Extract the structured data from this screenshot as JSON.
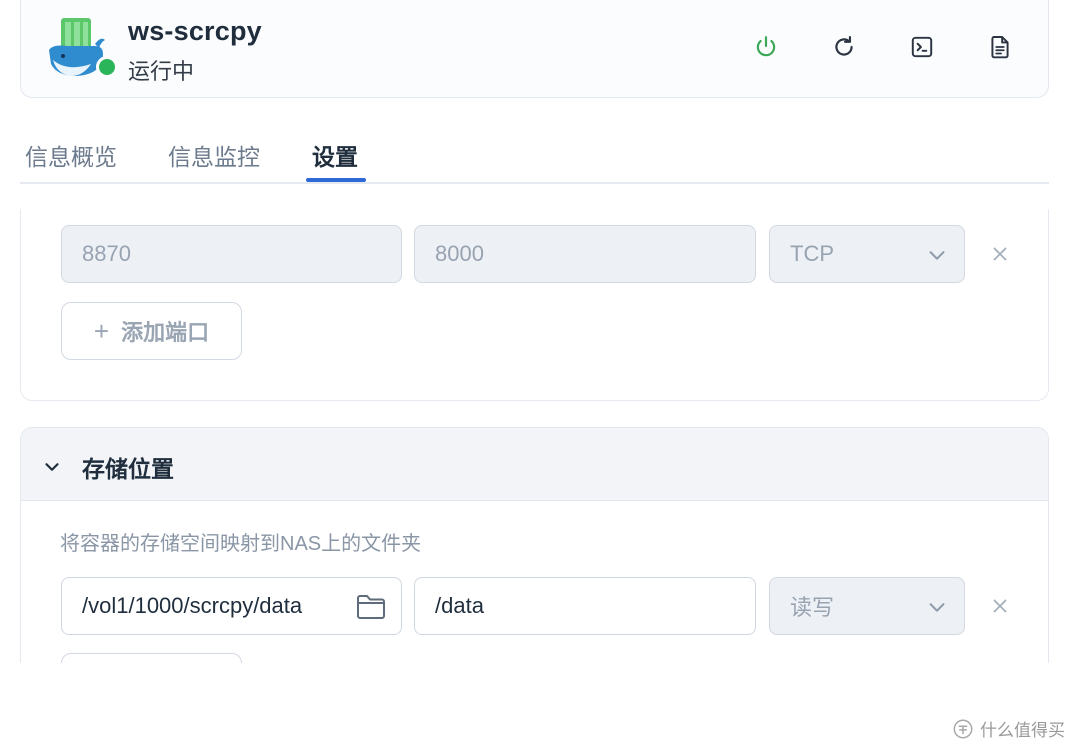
{
  "app": {
    "name": "ws-scrcpy",
    "status": "运行中",
    "status_color": "#2ab55a"
  },
  "toolbar": {
    "icons": [
      "power-icon",
      "refresh-icon",
      "terminal-icon",
      "log-file-icon"
    ],
    "power_color": "#3aa757"
  },
  "tabs": [
    {
      "label": "信息概览",
      "active": false
    },
    {
      "label": "信息监控",
      "active": false
    },
    {
      "label": "设置",
      "active": true
    }
  ],
  "accent_color": "#2d6ad6",
  "ports": {
    "rows": [
      {
        "host_port": "8870",
        "container_port": "8000",
        "protocol": "TCP"
      }
    ],
    "add_label": "添加端口"
  },
  "storage": {
    "title": "存储位置",
    "description": "将容器的存储空间映射到NAS上的文件夹",
    "rows": [
      {
        "host_path": "/vol1/1000/scrcpy/data",
        "container_path": "/data",
        "permission": "读写"
      }
    ]
  },
  "watermark": {
    "text": "什么值得买"
  }
}
